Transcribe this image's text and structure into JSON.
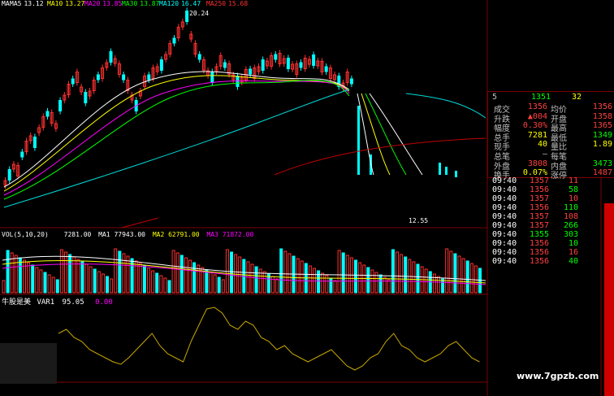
{
  "header": {
    "main_indicator": "MA",
    "ma_labels": [
      {
        "text": "MA5",
        "value": "13.12",
        "color": "#ffffff"
      },
      {
        "text": "MA10",
        "value": "13.27",
        "color": "#ffff00"
      },
      {
        "text": "MA20",
        "value": "13.85",
        "color": "#ff00ff"
      },
      {
        "text": "MA30",
        "value": "13.87",
        "color": "#00ff00"
      },
      {
        "text": "MA120",
        "value": "16.47",
        "color": "#00ffff"
      },
      {
        "text": "MA250",
        "value": "15.68",
        "color": "#ff3030"
      }
    ]
  },
  "price_panel": {
    "high_marker": "20.24",
    "low_marker": "12.55"
  },
  "volume_panel": {
    "title": "VOL(5,10,20)",
    "values": [
      {
        "label": "",
        "value": "7281.00",
        "color": "#ffffff"
      },
      {
        "label": "MA1",
        "value": "77943.00",
        "color": "#ffffff"
      },
      {
        "label": "MA2",
        "value": "62791.00",
        "color": "#ffff00"
      },
      {
        "label": "MA3",
        "value": "71872.00",
        "color": "#ff00ff"
      }
    ]
  },
  "indicator_panel": {
    "title": "牛股是美",
    "var_label": "VAR1",
    "var_value": "95.05",
    "extra_value": "0.00"
  },
  "quote_panel": {
    "top_left": "5",
    "top_mid": "1351",
    "top_right": "32",
    "rows": [
      {
        "l1": "成交",
        "v1": "1356",
        "l2": "均价",
        "v2": "1356",
        "c1": "#ff4040",
        "c2": "#ff4040"
      },
      {
        "l1": "升跌",
        "v1": "▲004",
        "l2": "开盘",
        "v2": "1358",
        "c1": "#ff4040",
        "c2": "#ff4040"
      },
      {
        "l1": "幅度",
        "v1": "0.30%",
        "l2": "最高",
        "v2": "1365",
        "c1": "#ff4040",
        "c2": "#ff4040"
      },
      {
        "l1": "总手",
        "v1": "7281",
        "l2": "最低",
        "v2": "1349",
        "c1": "#ffff00",
        "c2": "#00ff00"
      },
      {
        "l1": "现手",
        "v1": "40",
        "l2": "量比",
        "v2": "1.89",
        "c1": "#ffff00",
        "c2": "#ffff00"
      },
      {
        "l1": "总笔",
        "v1": "—",
        "l2": "每笔",
        "v2": "",
        "c1": "#c0c0c0",
        "c2": "#c0c0c0"
      },
      {
        "l1": "外盘",
        "v1": "3808",
        "l2": "内盘",
        "v2": "3473",
        "c1": "#ff4040",
        "c2": "#00ff00"
      },
      {
        "l1": "换手",
        "v1": "0.07%",
        "l2": "涨停",
        "v2": "1487",
        "c1": "#ffff00",
        "c2": "#ff4040"
      }
    ]
  },
  "trades": [
    {
      "time": "09:40",
      "price": "1357",
      "vol": "11"
    },
    {
      "time": "09:40",
      "price": "1356",
      "vol": "58"
    },
    {
      "time": "09:40",
      "price": "1357",
      "vol": "10"
    },
    {
      "time": "09:40",
      "price": "1356",
      "vol": "110"
    },
    {
      "time": "09:40",
      "price": "1357",
      "vol": "108"
    },
    {
      "time": "09:40",
      "price": "1357",
      "vol": "266"
    },
    {
      "time": "09:40",
      "price": "1355",
      "vol": "303"
    },
    {
      "time": "09:40",
      "price": "1356",
      "vol": "10"
    },
    {
      "time": "09:40",
      "price": "1356",
      "vol": "16"
    },
    {
      "time": "09:40",
      "price": "1356",
      "vol": "40"
    }
  ],
  "watermark": "www.7gpzb.com",
  "colors": {
    "up": "#ff3030",
    "down": "#00ffff",
    "grid": "#7a0000",
    "indicator_line": "#c8a800",
    "ma_white": "#ffffff",
    "ma_yellow": "#ffff00",
    "ma_pink": "#ff00ff",
    "ma_green": "#00ff00",
    "ma_cyan": "#00dcdc",
    "ma_red": "#c00000"
  }
}
